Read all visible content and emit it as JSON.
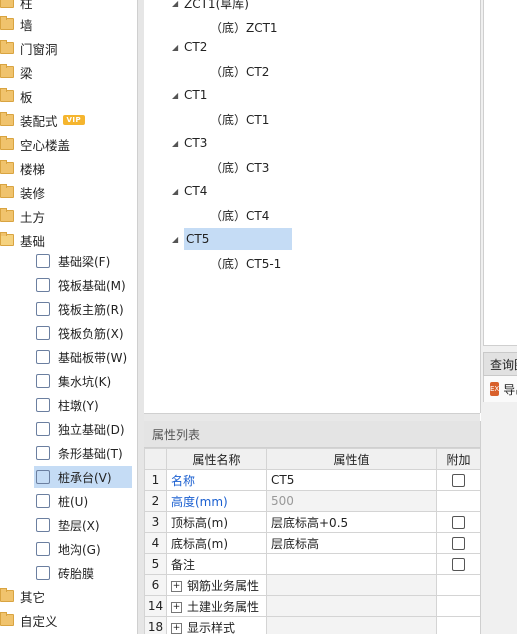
{
  "nav": {
    "categories": [
      {
        "label": "柱"
      },
      {
        "label": "墙"
      },
      {
        "label": "门窗洞"
      },
      {
        "label": "梁"
      },
      {
        "label": "板"
      },
      {
        "label": "装配式",
        "badge": "VIP"
      },
      {
        "label": "空心楼盖"
      },
      {
        "label": "楼梯"
      },
      {
        "label": "装修"
      },
      {
        "label": "土方"
      },
      {
        "label": "基础",
        "expanded": true
      }
    ],
    "foundation_items": [
      {
        "label": "基础梁(F)",
        "icon": "beam-icon"
      },
      {
        "label": "筏板基础(M)",
        "icon": "raft-icon"
      },
      {
        "label": "筏板主筋(R)",
        "icon": "rebar-icon"
      },
      {
        "label": "筏板负筋(X)",
        "icon": "neg-rebar-icon"
      },
      {
        "label": "基础板带(W)",
        "icon": "strip-icon"
      },
      {
        "label": "集水坑(K)",
        "icon": "sump-icon"
      },
      {
        "label": "柱墩(Y)",
        "icon": "pier-icon"
      },
      {
        "label": "独立基础(D)",
        "icon": "isolated-footing-icon"
      },
      {
        "label": "条形基础(T)",
        "icon": "strip-footing-icon"
      },
      {
        "label": "桩承台(V)",
        "icon": "pile-cap-icon",
        "selected": true
      },
      {
        "label": "桩(U)",
        "icon": "pile-icon"
      },
      {
        "label": "垫层(X)",
        "icon": "cushion-icon"
      },
      {
        "label": "地沟(G)",
        "icon": "trench-icon"
      },
      {
        "label": "砖胎膜",
        "icon": "brick-mold-icon"
      }
    ],
    "bottom_categories": [
      {
        "label": "其它"
      },
      {
        "label": "自定义"
      }
    ]
  },
  "tree": {
    "nodes": [
      {
        "label": "ZCT1(阜库)",
        "child": "（底）ZCT1"
      },
      {
        "label": "CT2",
        "child": "（底）CT2"
      },
      {
        "label": "CT1",
        "child": "（底）CT1"
      },
      {
        "label": "CT3",
        "child": "（底）CT3"
      },
      {
        "label": "CT4",
        "child": "（底）CT4"
      },
      {
        "label": "CT5",
        "child": "（底）CT5-1",
        "selected": true
      }
    ]
  },
  "props": {
    "title": "属性列表",
    "headers": {
      "num": "",
      "name": "属性名称",
      "value": "属性值",
      "extra": "附加"
    },
    "rows": [
      {
        "num": "1",
        "name": "名称",
        "value": "CT5",
        "checkbox": true,
        "blue": true
      },
      {
        "num": "2",
        "name": "高度(mm)",
        "value": "500",
        "checkbox": false,
        "blue": true,
        "gray": true
      },
      {
        "num": "3",
        "name": "顶标高(m)",
        "value": "层底标高+0.5",
        "checkbox": true
      },
      {
        "num": "4",
        "name": "底标高(m)",
        "value": "层底标高",
        "checkbox": true
      },
      {
        "num": "5",
        "name": "备注",
        "value": "",
        "checkbox": true
      },
      {
        "num": "6",
        "name": "钢筋业务属性",
        "value": "",
        "group": true
      },
      {
        "num": "14",
        "name": "土建业务属性",
        "value": "",
        "group": true
      },
      {
        "num": "18",
        "name": "显示样式",
        "value": "",
        "group": true
      }
    ]
  },
  "right": {
    "tab_label": "查询图元",
    "tool_label": "导出"
  }
}
